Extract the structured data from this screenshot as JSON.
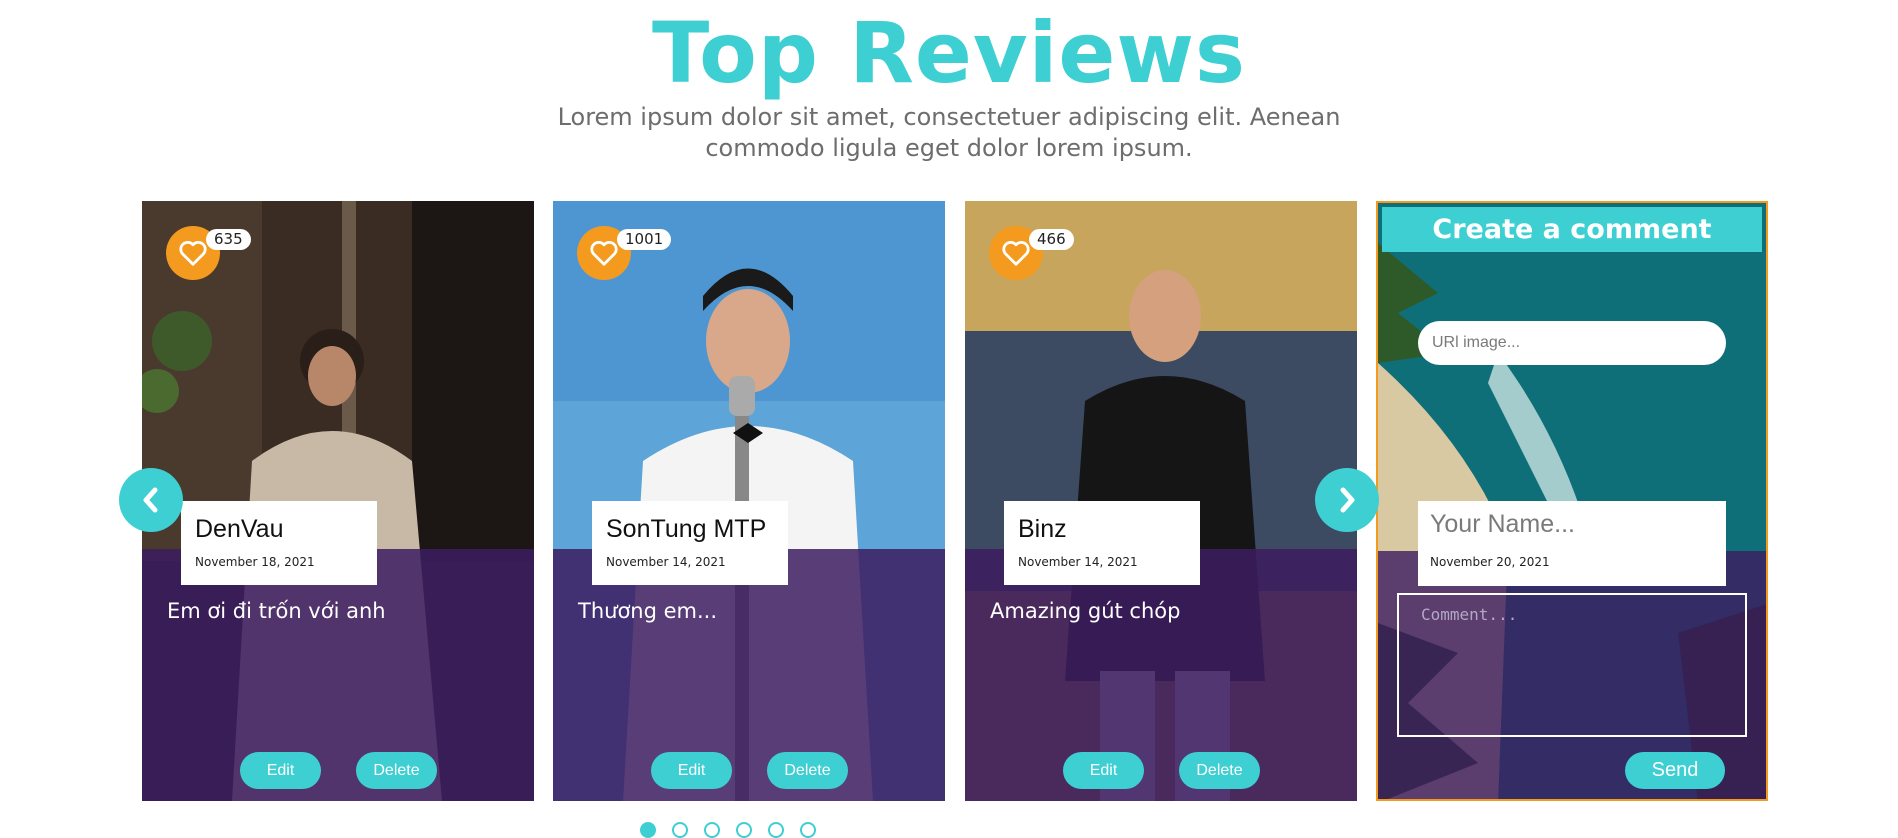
{
  "header": {
    "title": "Top Reviews",
    "subtitle": "Lorem ipsum dolor sit amet, consectetuer adipiscing elit. Aenean commodo ligula eget dolor lorem ipsum."
  },
  "colors": {
    "accent": "#3ecfd3",
    "like": "#f49b1f",
    "overlay": "#3c1c60"
  },
  "icons": {
    "like": "heart-outline-icon",
    "prev": "chevron-left-icon",
    "next": "chevron-right-icon"
  },
  "reviews": [
    {
      "likes": "635",
      "name": "DenVau",
      "date": "November 18, 2021",
      "text": "Em ơi đi trốn với anh",
      "edit_label": "Edit",
      "delete_label": "Delete"
    },
    {
      "likes": "1001",
      "name": "SonTung MTP",
      "date": "November 14, 2021",
      "text": "Thương em...",
      "edit_label": "Edit",
      "delete_label": "Delete"
    },
    {
      "likes": "466",
      "name": "Binz",
      "date": "November 14, 2021",
      "text": "Amazing gút chóp",
      "edit_label": "Edit",
      "delete_label": "Delete"
    }
  ],
  "create_comment": {
    "title": "Create a comment",
    "url_placeholder": "URl image...",
    "name_placeholder": "Your Name...",
    "date": "November 20, 2021",
    "comment_placeholder": "Comment...",
    "send_label": "Send"
  },
  "pagination": {
    "count": 6,
    "active_index": 0
  }
}
